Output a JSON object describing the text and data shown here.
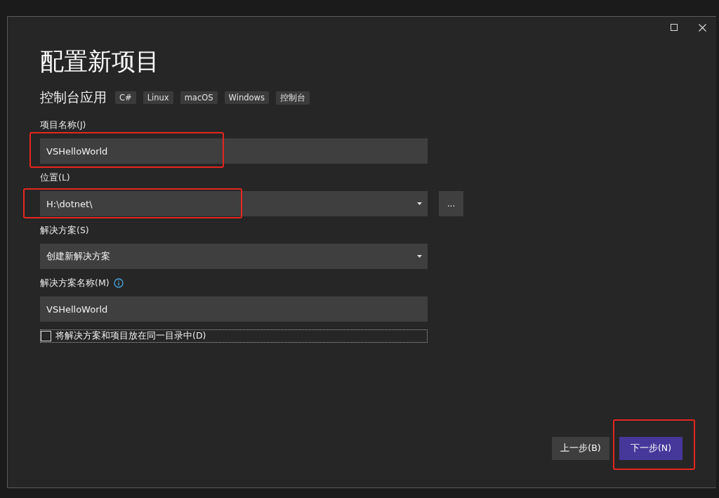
{
  "title": "配置新项目",
  "template": {
    "name": "控制台应用",
    "tags": [
      "C#",
      "Linux",
      "macOS",
      "Windows",
      "控制台"
    ]
  },
  "fields": [
    {
      "kind": "text",
      "label": "项目名称(J)",
      "value": "VSHelloWorld",
      "highlighted": true
    },
    {
      "kind": "dropdown",
      "label": "位置(L)",
      "value": "H:\\dotnet\\",
      "highlighted": true,
      "browse_button": "..."
    },
    {
      "kind": "dropdown",
      "label": "解决方案(S)",
      "value": "创建新解决方案",
      "highlighted": false
    },
    {
      "kind": "text",
      "label": "解决方案名称(M)",
      "value": "VSHelloWorld",
      "highlighted": false,
      "info": true
    }
  ],
  "checkbox": {
    "label": "将解决方案和项目放在同一目录中(D)",
    "checked": false
  },
  "buttons": [
    {
      "label": "上一步(B)",
      "primary": false,
      "highlighted": false
    },
    {
      "label": "下一步(N)",
      "primary": true,
      "highlighted": true
    }
  ]
}
